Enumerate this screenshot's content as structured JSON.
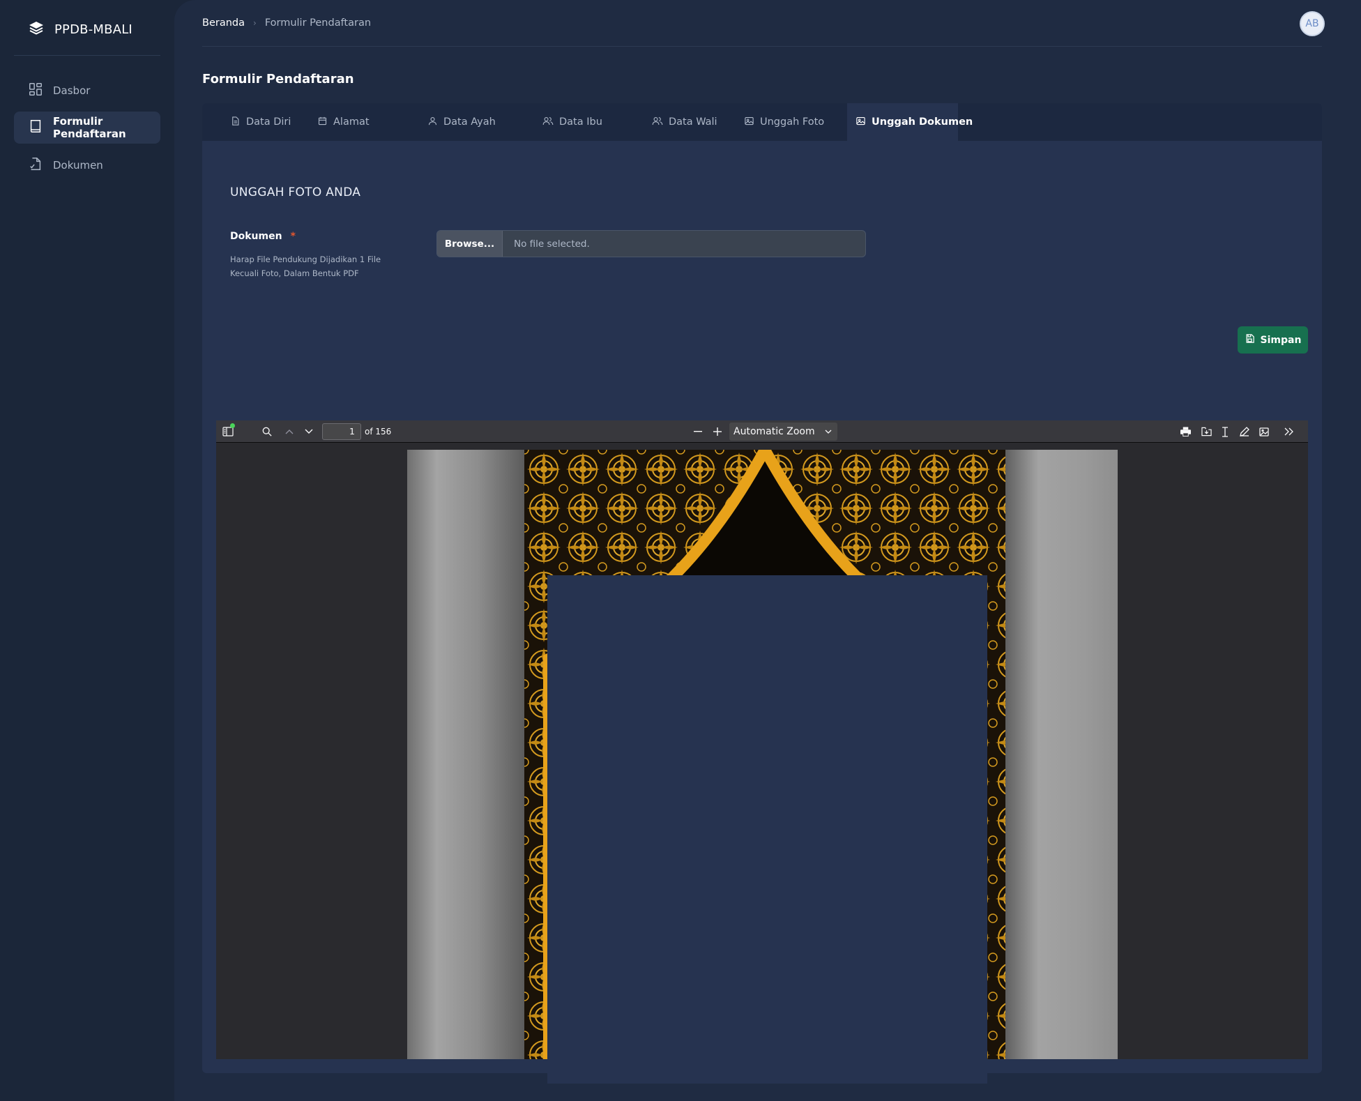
{
  "app": {
    "name": "PPDB-MBALI"
  },
  "sidebar": {
    "items": [
      {
        "label": "Dasbor",
        "icon": "dashboard-icon",
        "active": false
      },
      {
        "label": "Formulir Pendaftaran",
        "icon": "book-icon",
        "active": true
      },
      {
        "label": "Dokumen",
        "icon": "document-check-icon",
        "active": false
      }
    ]
  },
  "topbar": {
    "breadcrumb": [
      "Beranda",
      "Formulir Pendaftaran"
    ],
    "avatar_initials": "AB"
  },
  "page": {
    "title": "Formulir Pendaftaran"
  },
  "tabs": [
    {
      "label": "Data Diri",
      "icon": "document-text-icon",
      "active": false
    },
    {
      "label": "Alamat",
      "icon": "calendar-icon",
      "active": false
    },
    {
      "label": "Data Ayah",
      "icon": "user-icon",
      "active": false
    },
    {
      "label": "Data Ibu",
      "icon": "users-icon",
      "active": false
    },
    {
      "label": "Data Wali",
      "icon": "users-icon",
      "active": false
    },
    {
      "label": "Unggah Foto",
      "icon": "image-icon",
      "active": false
    },
    {
      "label": "Unggah Dokumen",
      "icon": "image-icon",
      "active": true
    }
  ],
  "form": {
    "section_title": "UNGGAH FOTO ANDA",
    "field_label": "Dokumen",
    "required_mark": "*",
    "hint": "Harap File Pendukung Dijadikan 1 File Kecuali Foto, Dalam Bentuk PDF",
    "browse_label": "Browse...",
    "file_status": "No file selected.",
    "save_label": "Simpan"
  },
  "pdf_viewer": {
    "current_page": "1",
    "page_count_label": "of 156",
    "zoom_label": "Automatic Zoom"
  },
  "colors": {
    "sidebar_bg": "#1b2639",
    "main_bg": "#1f2b42",
    "card_bg": "#263350",
    "save_button": "#17704f",
    "ornament_gold": "#d49a1e"
  }
}
